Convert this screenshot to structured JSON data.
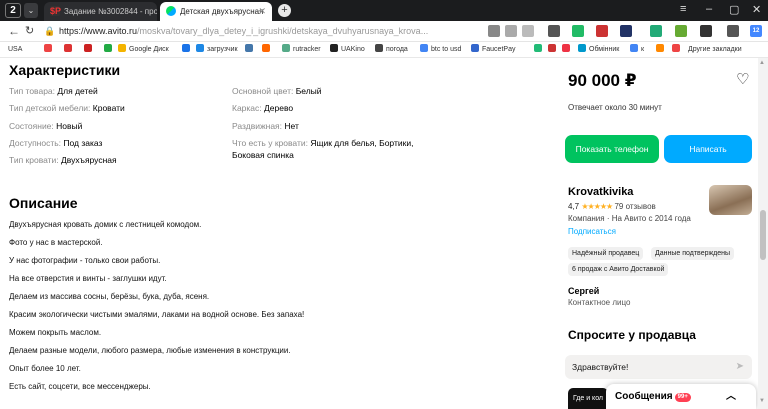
{
  "browser": {
    "window_count": "2",
    "tabs": [
      {
        "title": "Задание №3002844 - про",
        "favicon": "$P"
      },
      {
        "title": "Детская двухъярусная",
        "favicon": ""
      }
    ],
    "url_host": "https://www.avito.ru",
    "url_path": "/moskva/tovary_dlya_detey_i_igrushki/detskaya_dvuhyarusnaya_krova...",
    "bookmarks": [
      "USA",
      "Google Диск",
      "загрузчик",
      "rutracker",
      "UAKino",
      "погода",
      "btc to usd",
      "FaucetPay",
      "Обмінник",
      "к",
      "Другие закладки"
    ],
    "toolbar_badge": "12"
  },
  "characteristics": {
    "title": "Характеристики",
    "left": [
      {
        "key": "Тип товара:",
        "value": "Для детей"
      },
      {
        "key": "Тип детской мебели:",
        "value": "Кровати"
      },
      {
        "key": "Состояние:",
        "value": "Новый"
      },
      {
        "key": "Доступность:",
        "value": "Под заказ"
      },
      {
        "key": "Тип кровати:",
        "value": "Двухъярусная"
      }
    ],
    "right": [
      {
        "key": "Основной цвет:",
        "value": "Белый"
      },
      {
        "key": "Каркас:",
        "value": "Дерево"
      },
      {
        "key": "Раздвижная:",
        "value": "Нет"
      },
      {
        "key": "Что есть у кровати:",
        "value": "Ящик для белья, Бортики,"
      },
      {
        "key": "",
        "value": "Боковая спинка"
      }
    ]
  },
  "description": {
    "title": "Описание",
    "lines": [
      "Двухъярусная кровать домик с лестницей комодом.",
      "Фото у нас в мастерской.",
      "У нас фотографии - только свои работы.",
      "На все отверстия и винты - заглушки идут.",
      "Делаем из массива сосны, берёзы, бука, дуба, ясеня.",
      "Красим экологически чистыми эмалями, лаками на водной основе. Без запаха!",
      "Можем покрыть маслом.",
      "Делаем разные модели, любого размера, любые изменения в конструкции.",
      "Опыт более 10 лет.",
      "Есть сайт, соцсети, все мессенджеры."
    ]
  },
  "listing": {
    "price": "90 000 ₽",
    "reply_time": "Отвечает около 30 минут",
    "phone_button": "Показать телефон",
    "write_button": "Написать"
  },
  "seller": {
    "name": "Krovatkivika",
    "rating": "4,7",
    "stars": "★★★★★",
    "reviews": "79 отзывов",
    "company": "Компания · На Авито с 2014 года",
    "subscribe": "Подписаться",
    "chips": [
      "Надёжный продавец",
      "Данные подтверждены",
      "6 продаж с Авито Доставкой"
    ],
    "contact_name": "Сергей",
    "contact_role": "Контактное лицо"
  },
  "ask": {
    "title": "Спросите у продавца",
    "input_value": "Здравствуйте!",
    "where_label": "Где и кол"
  },
  "messages": {
    "label": "Сообщения",
    "badge": "99+"
  },
  "colors": {
    "green": "#00c35f",
    "blue": "#00aaff",
    "badge_red": "#ff4053"
  }
}
